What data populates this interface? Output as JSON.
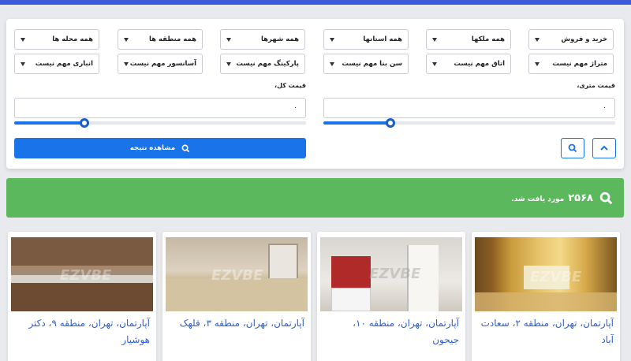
{
  "filters": {
    "row1": [
      "خرید و فروش",
      "همه ملکها",
      "همه استانها",
      "همه شهرها",
      "همه منطقه ها",
      "همه محله ها"
    ],
    "row2": [
      "متراژ مهم نیست",
      "اتاق مهم نیست",
      "سن بنا مهم نیست",
      "پارکینگ مهم نیست",
      "آسانسور مهم نیست",
      "انباری مهم نیست"
    ],
    "price_per_meter_label": "قیمت متری،",
    "price_total_label": "قیمت کل،",
    "price_per_meter_value": "۰",
    "price_total_value": "۰",
    "price_per_meter_slider": 0.23,
    "price_total_slider": 0.24,
    "show_results_label": "مشاهده نتیجه"
  },
  "results": {
    "count": "۲۵۶۸",
    "text": "مورد یافت شد."
  },
  "listings": [
    {
      "title": "آپارتمان، تهران، منطقه ۲، سعادت آباد"
    },
    {
      "title": "آپارتمان، تهران، منطقه ۱۰، جیحون"
    },
    {
      "title": "آپارتمان، تهران، منطقه ۳، قلهک"
    },
    {
      "title": "آپارتمان، تهران، منطقه ۹، دکتر هوشیار"
    }
  ],
  "watermark": "EZVBE",
  "colors": {
    "primary": "#1a73e8",
    "success": "#5bb85d",
    "link": "#3060d0",
    "topbar": "#3b5bdb"
  },
  "icons": {
    "search": "search-icon",
    "collapse": "chevron-up-icon",
    "dropdown": "caret-down-icon"
  }
}
